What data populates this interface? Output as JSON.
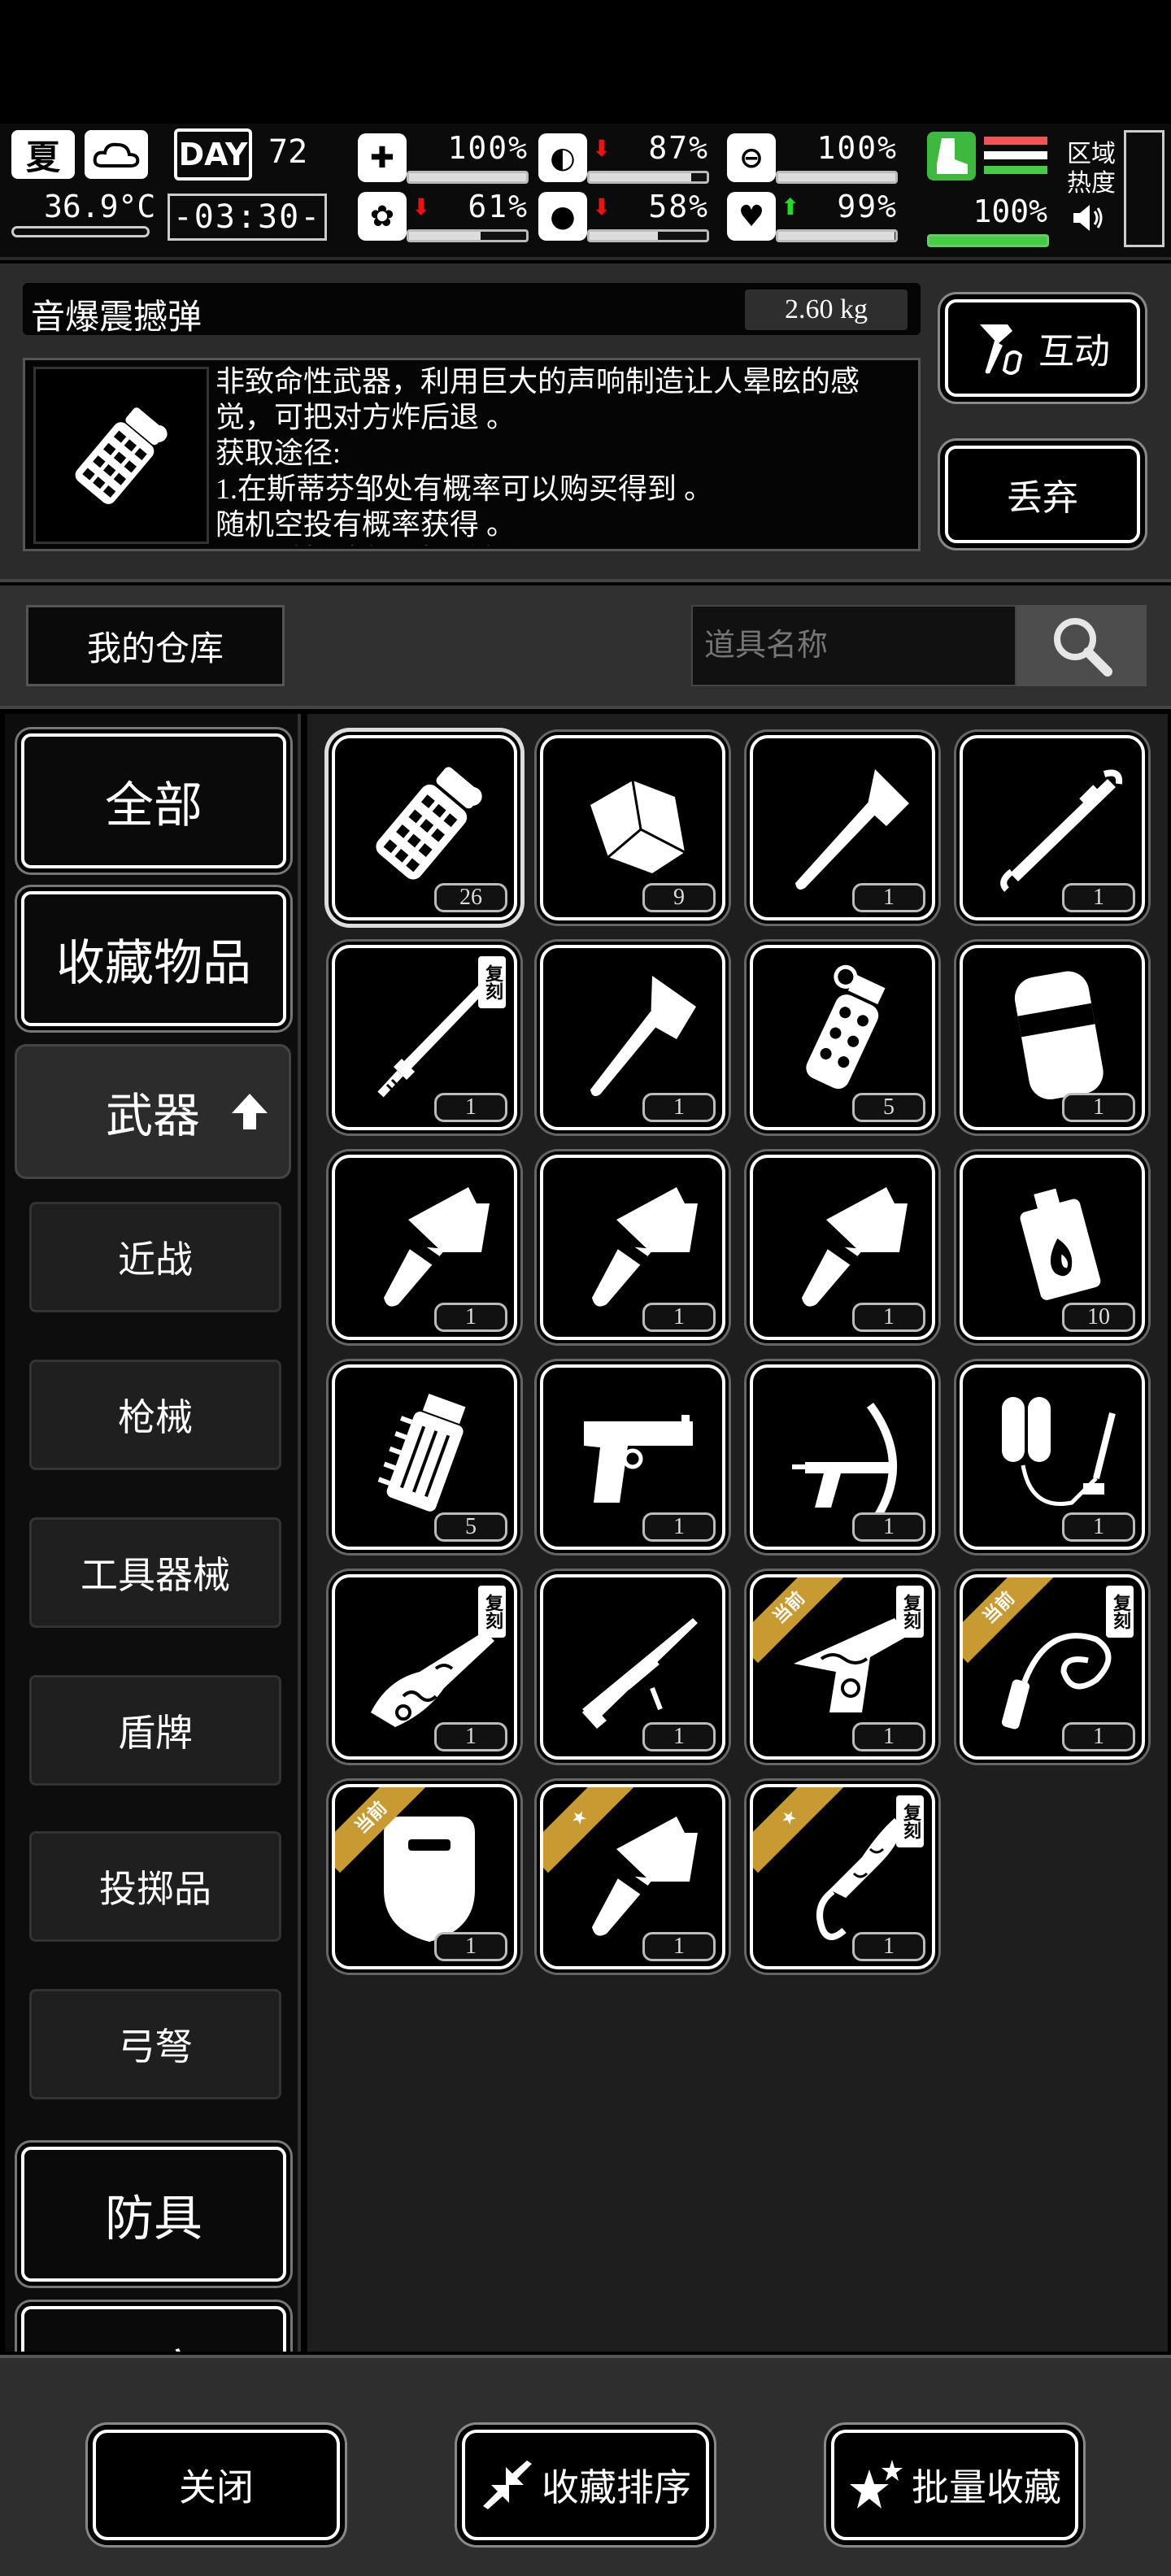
{
  "status": {
    "season": "夏",
    "temperature": "36.9°C",
    "day_label": "DAY",
    "day": "72",
    "time": "-03:30-",
    "stats": [
      {
        "name": "health",
        "icon": "medkit-icon",
        "value": "100%",
        "trend": "",
        "fill": 1.0
      },
      {
        "name": "hunger",
        "icon": "stomach-icon",
        "value": "87%",
        "trend": "down",
        "fill": 0.87
      },
      {
        "name": "stamina",
        "icon": "pill-icon",
        "value": "100%",
        "trend": "",
        "fill": 1.0
      },
      {
        "name": "sanity",
        "icon": "brain-icon",
        "value": "61%",
        "trend": "down",
        "fill": 0.61
      },
      {
        "name": "thirst",
        "icon": "water-drop-icon",
        "value": "58%",
        "trend": "down",
        "fill": 0.58
      },
      {
        "name": "mood",
        "icon": "heart-icon",
        "value": "99%",
        "trend": "up",
        "fill": 0.99
      }
    ],
    "boot_value": "100%",
    "region_heat_label": "区域热度"
  },
  "item_info": {
    "name": "音爆震撼弹",
    "weight": "2.60 kg",
    "description": "非致命性武器，利用巨大的声响制造让人晕眩的感觉，可把对方炸后退 。\n获取途径:\n1.在斯蒂芬邹处有概率可以购买得到 。\n随机空投有概率获得 。\n可通过拆除制作扳手制作",
    "interact_label": "互动",
    "discard_label": "丢弃"
  },
  "toolbar": {
    "warehouse_label": "我的仓库",
    "search_placeholder": "道具名称"
  },
  "categories": {
    "all": "全部",
    "favorites": "收藏物品",
    "weapons": "武器",
    "subs": [
      "近战",
      "枪械",
      "工具器械",
      "盾牌",
      "投掷品",
      "弓弩"
    ],
    "armor": "防具",
    "partial": "工房"
  },
  "tags": {
    "copy": "复刻",
    "current": "当前",
    "star": "★"
  },
  "items": [
    {
      "icon": "grenade-stun-icon",
      "count": "26"
    },
    {
      "icon": "rock-icon",
      "count": "9"
    },
    {
      "icon": "axe-icon",
      "count": "1"
    },
    {
      "icon": "crowbar-icon",
      "count": "1"
    },
    {
      "icon": "katana-icon",
      "count": "1",
      "copy": true
    },
    {
      "icon": "hatchet-icon",
      "count": "1"
    },
    {
      "icon": "frag-grenade-icon",
      "count": "5"
    },
    {
      "icon": "riot-shield-icon",
      "count": "1"
    },
    {
      "icon": "cleaver-icon",
      "count": "1"
    },
    {
      "icon": "cleaver-icon",
      "count": "1"
    },
    {
      "icon": "cleaver-icon",
      "count": "1"
    },
    {
      "icon": "molotov-box-icon",
      "count": "10"
    },
    {
      "icon": "spiked-grenade-icon",
      "count": "5"
    },
    {
      "icon": "pistol-icon",
      "count": "1"
    },
    {
      "icon": "crossbow-icon",
      "count": "1"
    },
    {
      "icon": "flamethrower-icon",
      "count": "1"
    },
    {
      "icon": "ornate-gun-icon",
      "count": "1",
      "copy": true
    },
    {
      "icon": "sniper-rifle-icon",
      "count": "1"
    },
    {
      "icon": "ornate-pistol-icon",
      "count": "1",
      "copy": true,
      "current": true
    },
    {
      "icon": "whip-icon",
      "count": "1",
      "copy": true,
      "current": true
    },
    {
      "icon": "shield-icon",
      "count": "1",
      "current": true
    },
    {
      "icon": "cleaver-icon",
      "count": "1",
      "star": true
    },
    {
      "icon": "ornate-blade-icon",
      "count": "1",
      "copy": true,
      "star": true
    }
  ],
  "bottom": {
    "close_label": "关闭",
    "sort_label": "收藏排序",
    "batch_label": "批量收藏"
  }
}
